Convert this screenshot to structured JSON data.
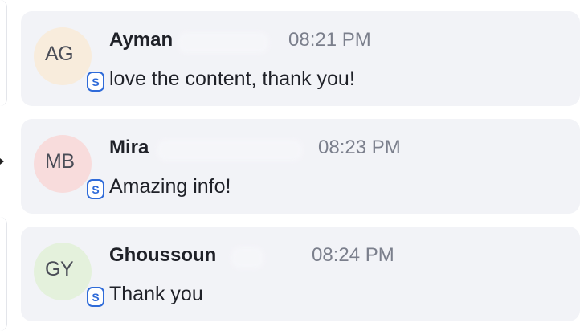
{
  "colors": {
    "card_bg": "#f2f3f7",
    "badge_accent": "#2f6bd9",
    "time_text": "#7b7f8c"
  },
  "messages": [
    {
      "initials": "AG",
      "name": "Ayman",
      "time": "08:21 PM",
      "text": "love the content, thank you!",
      "avatar_color": "#f8ecdc",
      "badge": "S",
      "badge_icon": "s-badge-icon"
    },
    {
      "initials": "MB",
      "name": "Mira",
      "time": "08:23 PM",
      "text": "Amazing info!",
      "avatar_color": "#f8dcdc",
      "badge": "S",
      "badge_icon": "s-badge-icon"
    },
    {
      "initials": "GY",
      "name": "Ghoussoun",
      "time": "08:24 PM",
      "text": "Thank you",
      "avatar_color": "#e4f1dc",
      "badge": "S",
      "badge_icon": "s-badge-icon"
    }
  ]
}
